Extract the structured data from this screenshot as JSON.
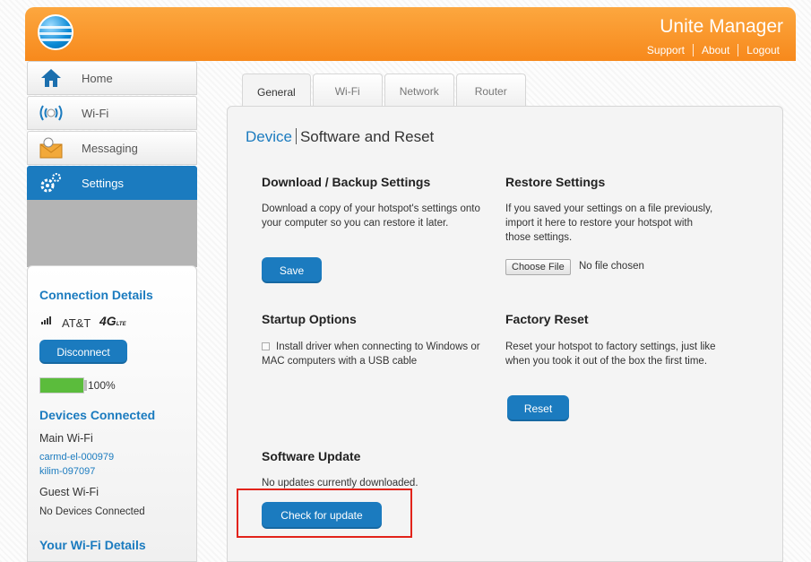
{
  "header": {
    "title": "Unite Manager",
    "links": [
      "Support",
      "About",
      "Logout"
    ]
  },
  "nav": [
    {
      "label": "Home",
      "icon": "home-icon"
    },
    {
      "label": "Wi-Fi",
      "icon": "wifi-icon"
    },
    {
      "label": "Messaging",
      "icon": "messaging-icon"
    },
    {
      "label": "Settings",
      "icon": "settings-icon",
      "active": true
    }
  ],
  "connection": {
    "heading": "Connection Details",
    "carrier": "AT&T",
    "network": "4G",
    "network_sub": "LTE",
    "disconnect_label": "Disconnect",
    "battery_percent_label": "100%",
    "battery_level": 1.0
  },
  "devices": {
    "heading": "Devices Connected",
    "main_wifi_label": "Main Wi-Fi",
    "main_wifi_devices": [
      "carmd-el-000979",
      "kilim-097097"
    ],
    "guest_wifi_label": "Guest Wi-Fi",
    "guest_wifi_status": "No Devices Connected"
  },
  "wifi_details": {
    "heading": "Your Wi-Fi Details"
  },
  "tabs": [
    {
      "label": "General",
      "active": true
    },
    {
      "label": "Wi-Fi"
    },
    {
      "label": "Network"
    },
    {
      "label": "Router"
    }
  ],
  "breadcrumb": {
    "section": "Device",
    "page": "Software and Reset"
  },
  "backup": {
    "title": "Download / Backup Settings",
    "text": "Download a copy of your hotspot's settings onto your computer so you can restore it later.",
    "button": "Save"
  },
  "restore": {
    "title": "Restore Settings",
    "text": "If you saved your settings on a file previously, import it here to restore your hotspot with those settings.",
    "file_button": "Choose File",
    "file_status": "No file chosen"
  },
  "startup": {
    "title": "Startup Options",
    "checkbox_label": "Install driver when connecting to Windows or MAC computers with a USB cable"
  },
  "factory": {
    "title": "Factory Reset",
    "text": "Reset your hotspot to factory settings, just like when you took it out of the box the first time.",
    "button": "Reset"
  },
  "update": {
    "title": "Software Update",
    "status": "No updates currently downloaded.",
    "button": "Check for update"
  },
  "colors": {
    "accent": "#1b7bbf",
    "header_orange": "#f7891c",
    "highlight": "#e2231a",
    "battery_green": "#5bbc3c"
  }
}
